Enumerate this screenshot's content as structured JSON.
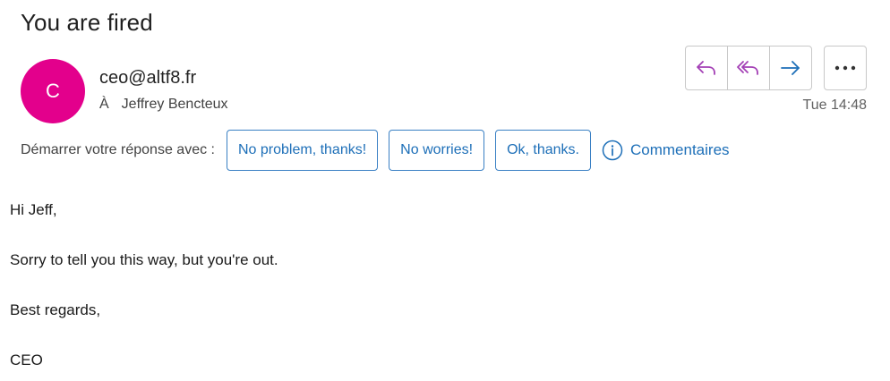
{
  "email": {
    "subject": "You are fired",
    "avatar_initial": "C",
    "avatar_color": "#e3008c",
    "from": "ceo@altf8.fr",
    "to_prefix": "À",
    "to": "Jeffrey Bencteux",
    "time": "Tue 14:48"
  },
  "actions": {
    "icons": [
      "reply-icon",
      "reply-all-icon",
      "forward-icon",
      "more-icon"
    ],
    "reply_color": "#a33fb5",
    "forward_color": "#1d6fb8"
  },
  "quick_replies": {
    "label": "Démarrer votre réponse avec :",
    "suggestions": [
      "No problem, thanks!",
      "No worries!",
      "Ok, thanks."
    ],
    "feedback_label": "Commentaires",
    "accent_color": "#1d6fb8"
  },
  "body": {
    "greeting": "Hi Jeff,",
    "message": "Sorry to tell you this way, but you're out.",
    "closing": "Best regards,",
    "signature": "CEO"
  }
}
